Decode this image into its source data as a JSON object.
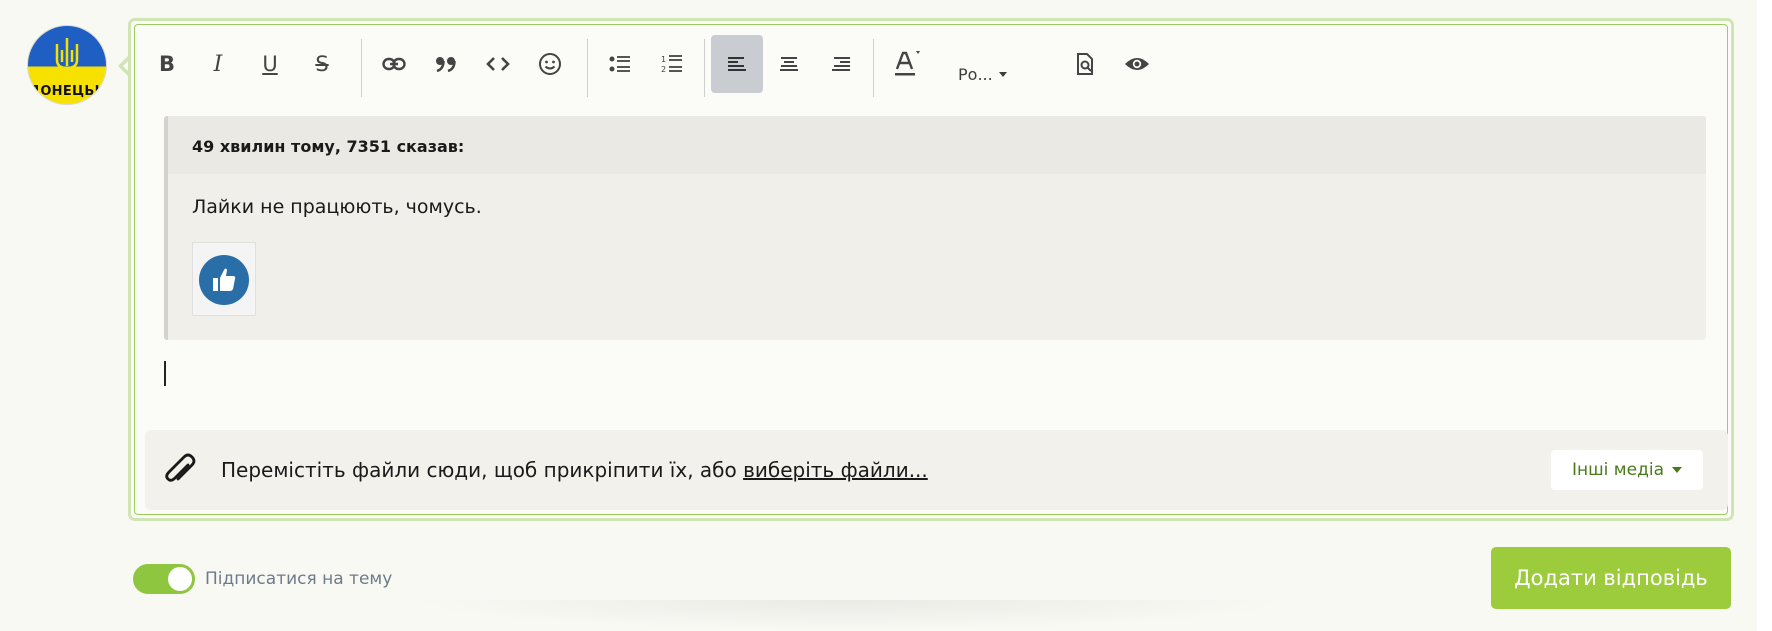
{
  "avatar": {
    "label": "ДОНЕЦЬК",
    "icon": "trident-icon"
  },
  "toolbar": {
    "bold": "B",
    "italic": "I",
    "underline": "U",
    "strike": "S",
    "font_selector": "Ро...",
    "icons": [
      "bold-icon",
      "italic-icon",
      "underline-icon",
      "strikethrough-icon",
      "link-icon",
      "quote-icon",
      "code-icon",
      "smiley-icon",
      "bullet-list-icon",
      "numbered-list-icon",
      "align-left-icon",
      "align-center-icon",
      "align-right-icon",
      "text-color-icon",
      "preview-icon",
      "eye-icon"
    ]
  },
  "quote": {
    "author": "49 хвилин тому, 7351 сказав:",
    "text": "Лайки не працюють, чомусь.",
    "image_icon": "thumbs-up-icon"
  },
  "attachments": {
    "prompt": "Перемістіть файли сюди, щоб прикріпити їх, або ",
    "link": "виберіть файли...",
    "other_media": "Інші медіа"
  },
  "subscribe": {
    "label": "Підписатися на тему",
    "on": true
  },
  "submit": {
    "label": "Додати відповідь"
  },
  "colors": {
    "accent": "#9ccb3b",
    "frame": "#9ccd5c",
    "link_green": "#4a7a1c"
  }
}
